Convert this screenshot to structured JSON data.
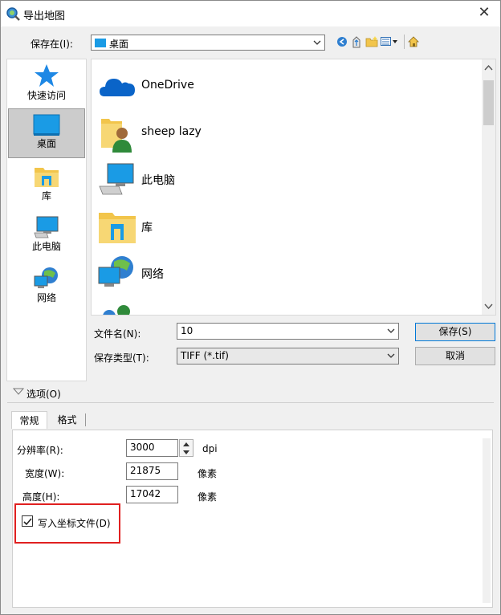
{
  "window": {
    "title": "导出地图"
  },
  "save_in": {
    "label": "保存在(I):",
    "value": "桌面"
  },
  "places": [
    {
      "label": "快速访问",
      "icon": "star-icon"
    },
    {
      "label": "桌面",
      "icon": "desktop-icon"
    },
    {
      "label": "库",
      "icon": "library-icon"
    },
    {
      "label": "此电脑",
      "icon": "computer-icon"
    },
    {
      "label": "网络",
      "icon": "network-icon"
    }
  ],
  "files": [
    {
      "name": "OneDrive",
      "icon": "onedrive-icon"
    },
    {
      "name": "sheep lazy",
      "icon": "user-folder-icon"
    },
    {
      "name": "此电脑",
      "icon": "computer-icon"
    },
    {
      "name": "库",
      "icon": "library-icon"
    },
    {
      "name": "网络",
      "icon": "network-icon"
    }
  ],
  "filename": {
    "label": "文件名(N):",
    "value": "10"
  },
  "filetype": {
    "label": "保存类型(T):",
    "value": "TIFF (*.tif)"
  },
  "buttons": {
    "save": "保存(S)",
    "cancel": "取消"
  },
  "options": {
    "label": "选项(O)"
  },
  "tabs": [
    {
      "label": "常规"
    },
    {
      "label": "格式"
    }
  ],
  "resolution": {
    "label": "分辨率(R):",
    "value": "3000",
    "unit": "dpi"
  },
  "width": {
    "label": "宽度(W):",
    "value": "21875",
    "unit": "像素"
  },
  "height": {
    "label": "高度(H):",
    "value": "17042",
    "unit": "像素"
  },
  "world_file": {
    "label": "写入坐标文件(D)",
    "checked": true
  },
  "colors": {
    "accent": "#0078d7",
    "highlight": "#e02020"
  }
}
